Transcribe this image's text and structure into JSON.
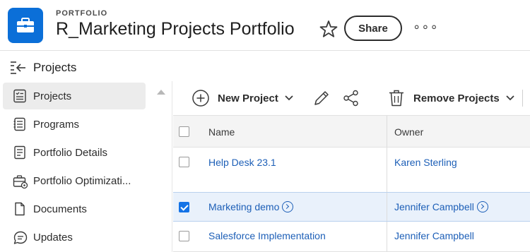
{
  "header": {
    "kicker": "PORTFOLIO",
    "title": "R_Marketing Projects Portfolio",
    "share_label": "Share",
    "more_label": "∘∘∘",
    "app_icon": "briefcase-icon",
    "accent": "#0b6fd8"
  },
  "subheader": {
    "title": "Projects",
    "icon": "collapse-panel-icon"
  },
  "sidebar": {
    "items": [
      {
        "label": "Projects",
        "icon": "projects-icon",
        "active": true
      },
      {
        "label": "Programs",
        "icon": "programs-icon",
        "active": false
      },
      {
        "label": "Portfolio Details",
        "icon": "details-icon",
        "active": false
      },
      {
        "label": "Portfolio Optimizati...",
        "icon": "optimization-icon",
        "active": false
      },
      {
        "label": "Documents",
        "icon": "document-icon",
        "active": false
      },
      {
        "label": "Updates",
        "icon": "updates-icon",
        "active": false
      }
    ]
  },
  "toolbar": {
    "new_project_label": "New Project",
    "remove_projects_label": "Remove Projects"
  },
  "table": {
    "columns": [
      "Name",
      "Owner"
    ],
    "rows": [
      {
        "name": "Help Desk 23.1",
        "owner": "Karen Sterling",
        "checked": false,
        "selected": false
      },
      {
        "name": "Marketing demo",
        "owner": "Jennifer Campbell",
        "checked": true,
        "selected": true
      },
      {
        "name": "Salesforce Implementation",
        "owner": "Jennifer Campbell",
        "checked": false,
        "selected": false
      }
    ]
  }
}
